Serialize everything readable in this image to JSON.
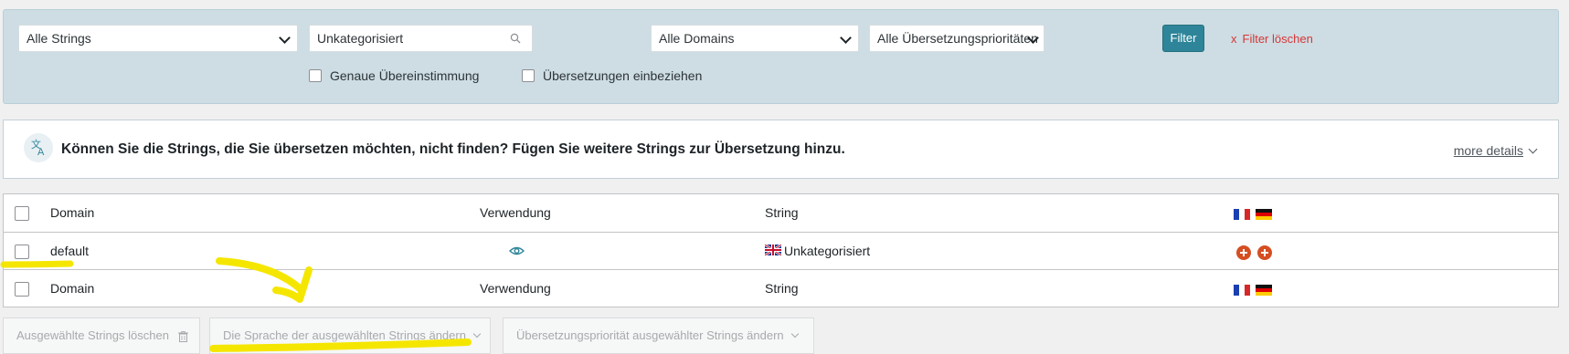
{
  "filter": {
    "strings_select": "Alle Strings",
    "search_value": "Unkategorisiert",
    "domains_select": "Alle Domains",
    "priority_select": "Alle Übersetzungsprioritäten",
    "filter_button": "Filter",
    "clear_label": "Filter löschen",
    "clear_x": "x",
    "exact_match": "Genaue Übereinstimmung",
    "include_translations": "Übersetzungen einbeziehen"
  },
  "notice": {
    "text": "Können Sie die Strings, die Sie übersetzen möchten, nicht finden? Fügen Sie weitere Strings zur Übersetzung hinzu.",
    "more_details": "more details"
  },
  "table": {
    "header": {
      "domain": "Domain",
      "usage": "Verwendung",
      "string": "String"
    },
    "rows": [
      {
        "domain": "default",
        "string": "Unkategorisiert"
      }
    ],
    "footer": {
      "domain": "Domain",
      "usage": "Verwendung",
      "string": "String"
    }
  },
  "bulk_actions": {
    "delete": "Ausgewählte Strings löschen",
    "change_language": "Die Sprache der ausgewählten Strings ändern",
    "change_priority": "Übersetzungspriorität ausgewählter Strings ändern"
  },
  "colors": {
    "panel": "#cddde3",
    "filter_button": "#2e8599",
    "clear_link": "#d63638",
    "add_translation": "#d54e21",
    "annotation": "#f5e600"
  },
  "icons": [
    "chevron-down-icon",
    "search-icon",
    "translate-icon",
    "eye-icon",
    "flag-fr-icon",
    "flag-de-icon",
    "flag-uk-icon",
    "plus-circle-icon",
    "trash-icon"
  ]
}
